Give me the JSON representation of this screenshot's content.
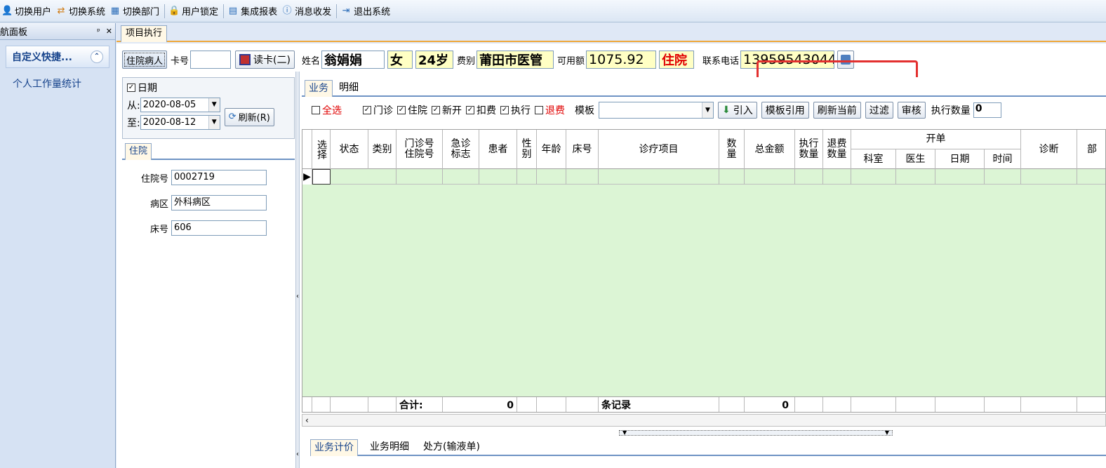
{
  "toolbar": {
    "items": [
      {
        "label": "切换用户",
        "icon": "switch-user-icon"
      },
      {
        "label": "切换系统",
        "icon": "switch-system-icon"
      },
      {
        "label": "切换部门",
        "icon": "switch-department-icon"
      },
      {
        "label": "用户锁定",
        "icon": "user-lock-icon"
      },
      {
        "label": "集成报表",
        "icon": "report-icon"
      },
      {
        "label": "消息收发",
        "icon": "message-icon"
      },
      {
        "label": "退出系统",
        "icon": "exit-icon"
      }
    ]
  },
  "nav": {
    "title": "航面板",
    "pin": "ᵖ",
    "close": "✕",
    "group_title": "自定义快捷...",
    "group_toggle": "⌃",
    "items": [
      "个人工作量统计"
    ]
  },
  "doc_tab": "项目执行",
  "patient": {
    "mode_button": "住院病人",
    "card_label": "卡号",
    "card_value": "",
    "read_card_button": "读卡(二)",
    "name_label": "姓名",
    "name": "翁娟娟",
    "gender": "女",
    "age": "24岁",
    "fee_type_label": "费别",
    "fee_type": "莆田市医管",
    "available_label": "可用额",
    "available": "1075.92",
    "status": "住院",
    "phone_label": "联系电话",
    "phone": "13959543044"
  },
  "filter": {
    "date_label": "日期",
    "date_checked": true,
    "from_label": "从:",
    "from_date": "2020-08-05",
    "to_label": "至:",
    "to_date": "2020-08-12",
    "refresh_button": "刷新(R)"
  },
  "inpatient": {
    "tab": "住院",
    "fields": [
      {
        "label": "住院号",
        "value": "0002719"
      },
      {
        "label": "病区",
        "value": "外科病区"
      },
      {
        "label": "床号",
        "value": "606"
      }
    ]
  },
  "business": {
    "tabs": [
      "业务",
      "明细"
    ],
    "options": {
      "select_all": "全选",
      "outpatient": "门诊",
      "inpatient": "住院",
      "new": "新开",
      "deduct": "扣费",
      "execute": "执行",
      "refund": "退费"
    },
    "template_label": "模板",
    "template_value": "",
    "import_button": "引入",
    "template_ref_button": "模板引用",
    "refresh_current_button": "刷新当前",
    "filter_button": "过滤",
    "audit_button": "审核",
    "exec_qty_label": "执行数量",
    "exec_qty_value": "0"
  },
  "grid": {
    "headers": {
      "select": "选择",
      "status": "状态",
      "category": "类别",
      "visit_no": "门诊号住院号",
      "emergency": "急诊标志",
      "patient": "患者",
      "sex": "性别",
      "age": "年龄",
      "bed": "床号",
      "item": "诊疗项目",
      "qty": "数量",
      "total": "总金额",
      "exec_qty": "执行数量",
      "refund_qty": "退费数量",
      "order_group": "开单",
      "dept": "科室",
      "doctor": "医生",
      "date": "日期",
      "time": "时间",
      "diagnosis": "诊断",
      "more": "部"
    },
    "footer": {
      "sum_label": "合计:",
      "patient_count": "0",
      "records_label": "条记录",
      "total_amount": "0"
    }
  },
  "bottom_tabs": [
    "业务计价",
    "业务明细",
    "处方(输液单)"
  ],
  "colors": {
    "grid_bg": "#dcf5d5",
    "highlight": "#e3302f",
    "yellow_field": "#ffffc4",
    "accent": "#15428b"
  }
}
